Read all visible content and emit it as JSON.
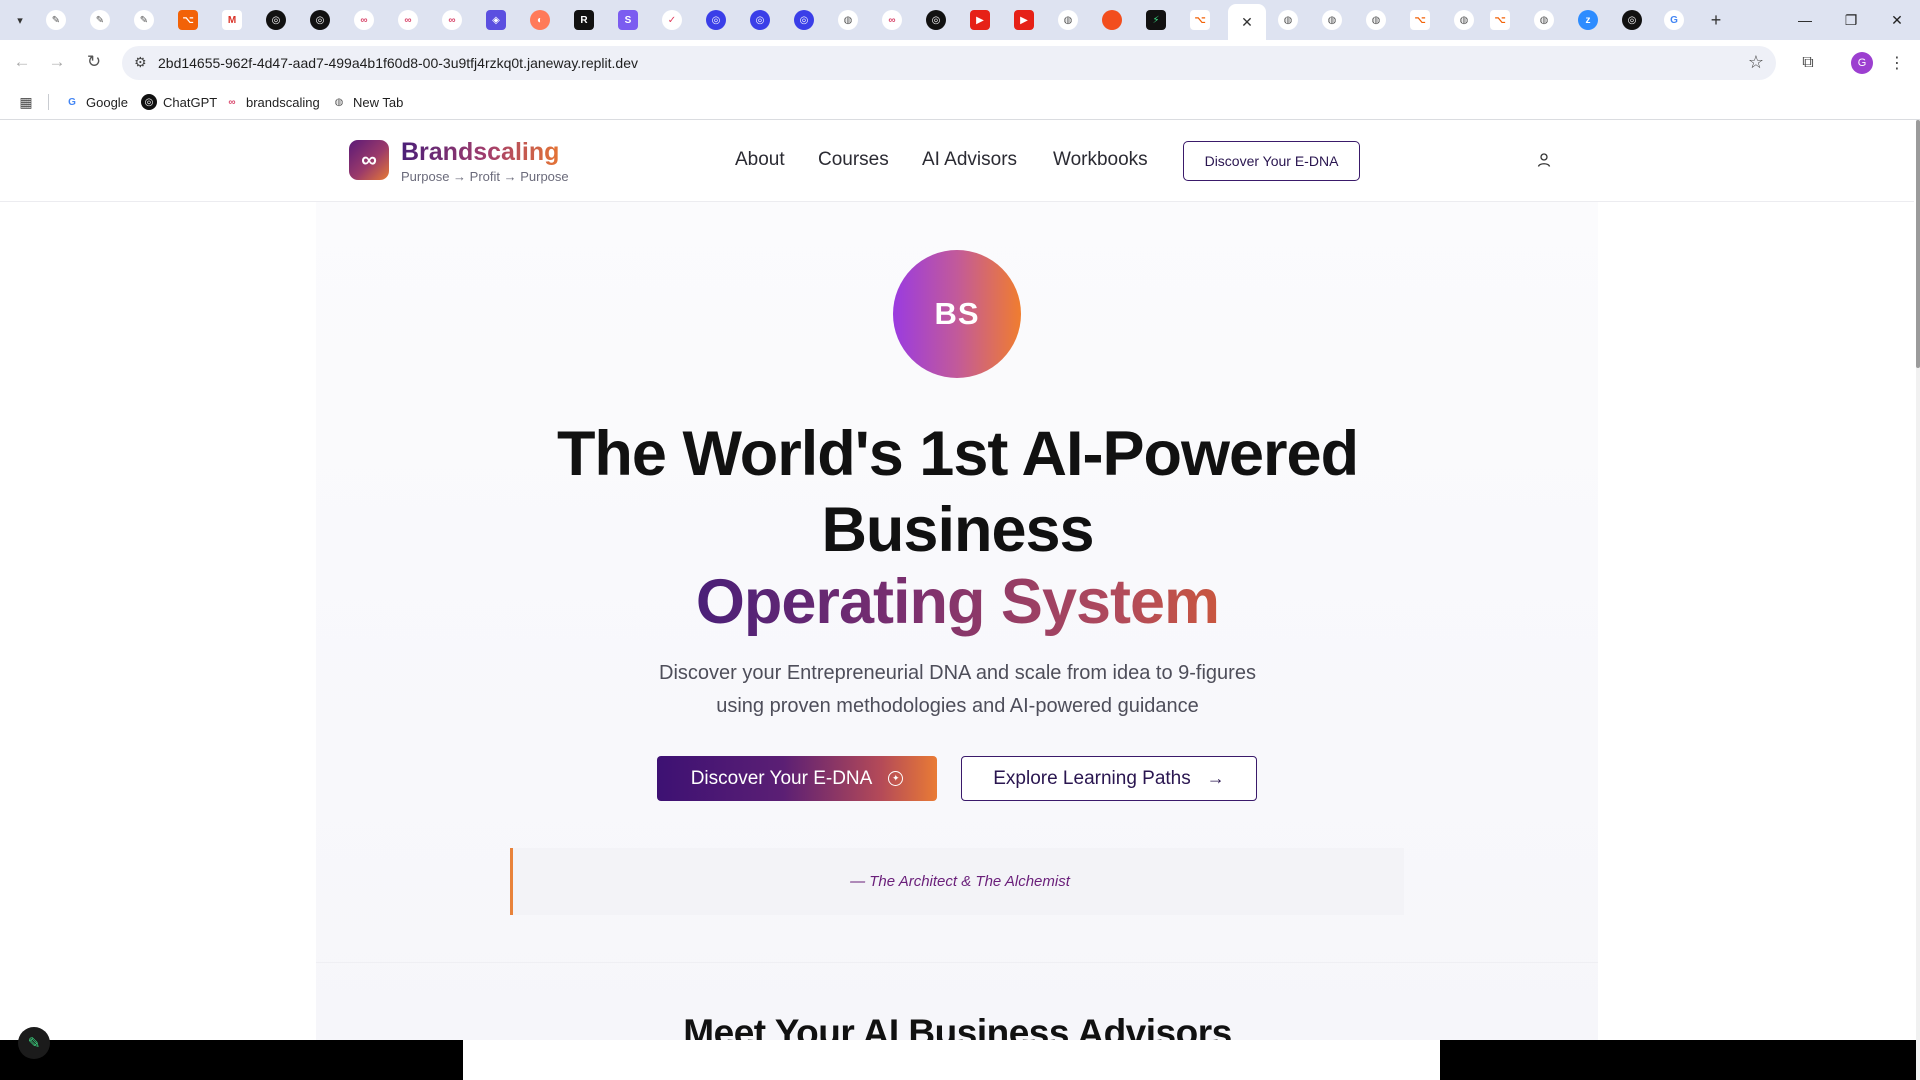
{
  "browser": {
    "tabs_active_close": "✕",
    "new_tab": "+",
    "url": "2bd14655-962f-4d47-aad7-499a4b1f60d8-00-3u9tfj4rzkq0t.janeway.replit.dev",
    "profile_initial": "G",
    "bookmarks": [
      {
        "label": "Google"
      },
      {
        "label": "ChatGPT"
      },
      {
        "label": "brandscaling"
      },
      {
        "label": "New Tab"
      }
    ]
  },
  "site": {
    "brand": {
      "logo_symbol": "∞",
      "name": "Brandscaling",
      "tagline": "Purpose → Profit → Purpose"
    },
    "nav": {
      "about": "About",
      "courses": "Courses",
      "ai_advisors": "AI Advisors",
      "workbooks": "Workbooks",
      "cta": "Discover Your E-DNA"
    },
    "hero": {
      "avatar_initials": "BS",
      "title_line1": "The World's 1st AI-Powered",
      "title_line2": "Business",
      "title_accent": "Operating System",
      "subtitle_line1": "Discover your Entrepreneurial DNA and scale from idea to 9-figures",
      "subtitle_line2": "using proven methodologies and AI-powered guidance",
      "primary_button": "Discover Your E-DNA",
      "secondary_button": "Explore Learning Paths",
      "quote_attribution": "— The Architect & The Alchemist"
    },
    "advisors_section": {
      "title": "Meet Your AI Business Advisors"
    }
  },
  "colors": {
    "brand_purple": "#4a1f78",
    "brand_orange": "#e97b35",
    "quote_accent": "#e8823a"
  }
}
